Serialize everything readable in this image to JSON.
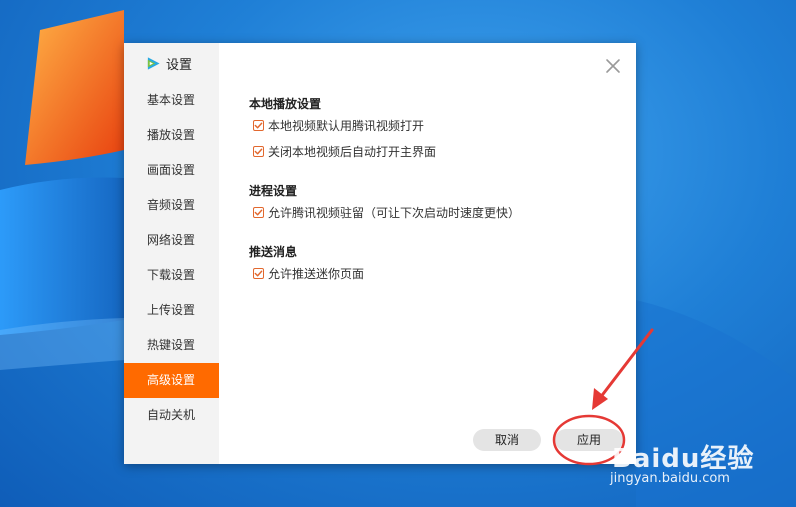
{
  "window": {
    "title": "设置"
  },
  "sidebar": {
    "items": [
      {
        "label": "基本设置",
        "active": false
      },
      {
        "label": "播放设置",
        "active": false
      },
      {
        "label": "画面设置",
        "active": false
      },
      {
        "label": "音频设置",
        "active": false
      },
      {
        "label": "网络设置",
        "active": false
      },
      {
        "label": "下载设置",
        "active": false
      },
      {
        "label": "上传设置",
        "active": false
      },
      {
        "label": "热键设置",
        "active": false
      },
      {
        "label": "高级设置",
        "active": true
      },
      {
        "label": "自动关机",
        "active": false
      }
    ]
  },
  "sections": [
    {
      "title": "本地播放设置",
      "options": [
        {
          "label": "本地视频默认用腾讯视频打开",
          "checked": true
        },
        {
          "label": "关闭本地视频后自动打开主界面",
          "checked": true
        }
      ]
    },
    {
      "title": "进程设置",
      "options": [
        {
          "label": "允许腾讯视频驻留（可让下次启动时速度更快）",
          "checked": true
        }
      ]
    },
    {
      "title": "推送消息",
      "options": [
        {
          "label": "允许推送迷你页面",
          "checked": true
        }
      ]
    }
  ],
  "buttons": {
    "cancel": "取消",
    "apply": "应用"
  },
  "watermark": {
    "brand": "Baidu经验",
    "url": "jingyan.baidu.com"
  },
  "colors": {
    "accent": "#ff6a00",
    "checkbox": "#e2682e",
    "annotation": "#e53935"
  }
}
